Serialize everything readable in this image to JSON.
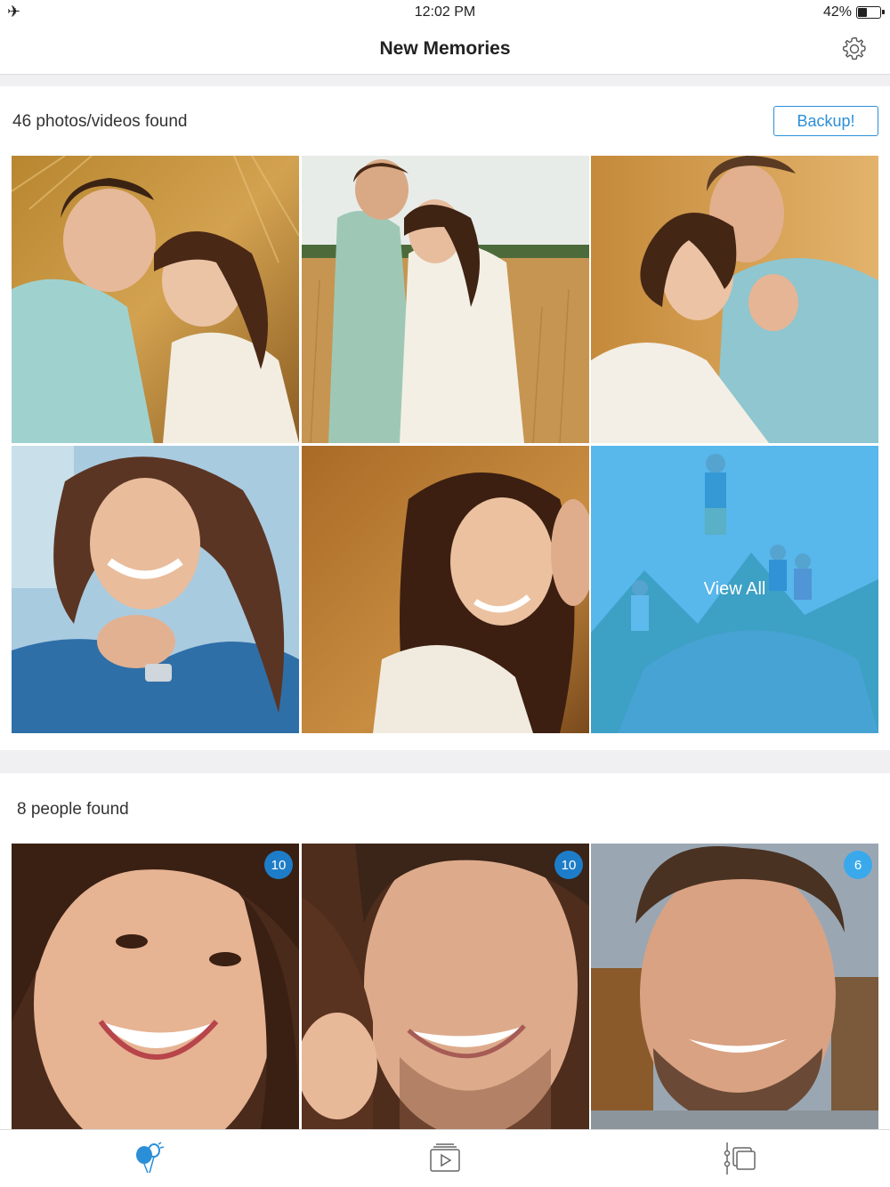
{
  "status_bar": {
    "time": "12:02 PM",
    "battery_percent": "42%",
    "battery_level": 0.42,
    "airplane_mode_icon": "airplane-icon"
  },
  "nav": {
    "title": "New Memories",
    "settings_icon": "gear-icon"
  },
  "memories": {
    "found_label": "46 photos/videos found",
    "backup_label": "Backup!",
    "view_all_label": "View All",
    "photos": [
      {
        "name": "couple-lying-in-wheat"
      },
      {
        "name": "couple-standing-in-field"
      },
      {
        "name": "couple-embracing-closeup"
      },
      {
        "name": "woman-smiling-by-sea"
      },
      {
        "name": "woman-smiling-golden-field"
      },
      {
        "name": "friends-jumping-on-rock"
      }
    ]
  },
  "people": {
    "found_label": "8 people found",
    "items": [
      {
        "count": "10",
        "badge_color": "#1e7dc8"
      },
      {
        "count": "10",
        "badge_color": "#1e7dc8"
      },
      {
        "count": "6",
        "badge_color": "#3aa9ec"
      }
    ]
  },
  "tabs": [
    {
      "icon": "balloons-icon",
      "active": true
    },
    {
      "icon": "video-play-icon",
      "active": false
    },
    {
      "icon": "gallery-timeline-icon",
      "active": false
    }
  ],
  "colors": {
    "accent": "#2b8fd8",
    "overlay": "#34aaeb"
  }
}
